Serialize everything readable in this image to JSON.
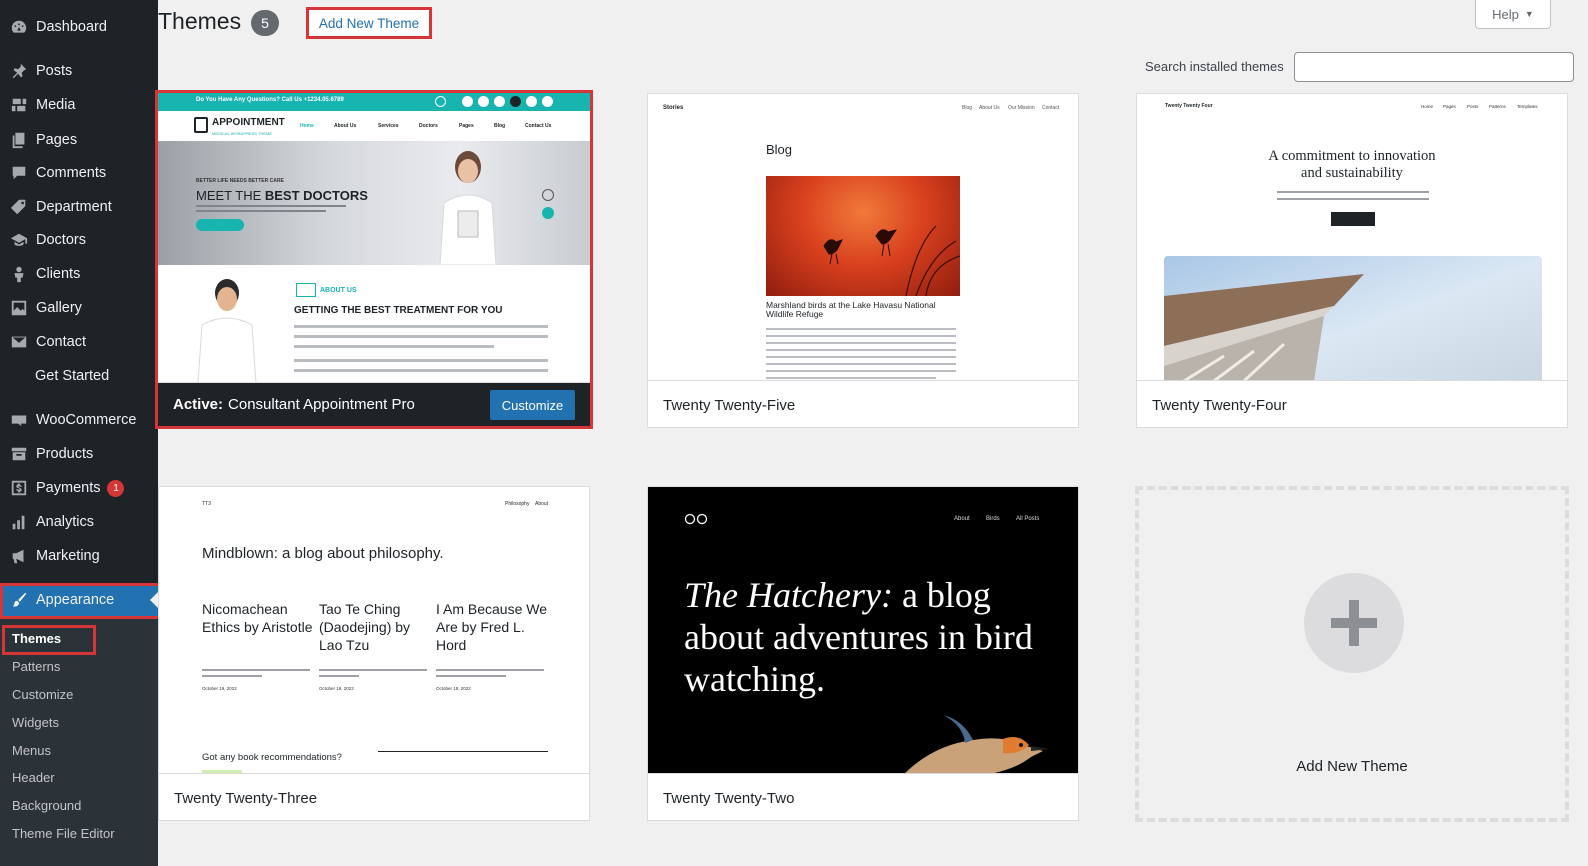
{
  "sidebar": {
    "items": [
      {
        "label": "Dashboard",
        "icon": "dashboard-icon"
      },
      {
        "label": "Posts",
        "icon": "pin-icon"
      },
      {
        "label": "Media",
        "icon": "media-icon"
      },
      {
        "label": "Pages",
        "icon": "pages-icon"
      },
      {
        "label": "Comments",
        "icon": "comment-icon"
      },
      {
        "label": "Department",
        "icon": "tag-icon"
      },
      {
        "label": "Doctors",
        "icon": "graduation-cap-icon"
      },
      {
        "label": "Clients",
        "icon": "person-icon"
      },
      {
        "label": "Gallery",
        "icon": "gallery-icon"
      },
      {
        "label": "Contact",
        "icon": "envelope-icon"
      },
      {
        "label": "Get Started",
        "icon": ""
      },
      {
        "label": "WooCommerce",
        "icon": "woo-icon"
      },
      {
        "label": "Products",
        "icon": "archive-icon"
      },
      {
        "label": "Payments",
        "icon": "dollar-icon",
        "badge": "1"
      },
      {
        "label": "Analytics",
        "icon": "bar-chart-icon"
      },
      {
        "label": "Marketing",
        "icon": "megaphone-icon"
      },
      {
        "label": "Appearance",
        "icon": "brush-icon"
      }
    ],
    "submenu": [
      "Themes",
      "Patterns",
      "Customize",
      "Widgets",
      "Menus",
      "Header",
      "Background",
      "Theme File Editor"
    ]
  },
  "header": {
    "title": "Themes",
    "count": "5",
    "add_new_label": "Add New Theme",
    "help_label": "Help",
    "search_label": "Search installed themes",
    "search_value": ""
  },
  "themes": {
    "active": {
      "prefix": "Active:",
      "name": "Consultant Appointment Pro",
      "customize_label": "Customize",
      "preview": {
        "topbar_text": "Do You Have Any Questions? Call Us +1234.05.6789",
        "logo": "APPOINTMENT",
        "logo_sub": "MEDICAL WORDPRESS THEME",
        "menu": [
          "Home",
          "About Us",
          "Services",
          "Doctors",
          "Pages",
          "Blog",
          "Contact Us"
        ],
        "hero_small": "BETTER LIFE NEEDS BETTER CARE",
        "hero_title_normal": "MEET THE ",
        "hero_title_bold": "BEST DOCTORS",
        "about_tag": "ABOUT US",
        "about_title": "GETTING THE BEST TREATMENT FOR YOU"
      }
    },
    "tt5": {
      "name": "Twenty Twenty-Five",
      "preview": {
        "site": "Stories",
        "nav": [
          "Blog",
          "About Us",
          "Our Mission",
          "Contact"
        ],
        "heading": "Blog",
        "caption": "Marshland birds at the Lake Havasu National Wildlife Refuge"
      }
    },
    "tt4": {
      "name": "Twenty Twenty-Four",
      "preview": {
        "site": "Twenty Twenty Four",
        "nav": [
          "Home",
          "Pages",
          "Posts",
          "Patterns",
          "Templates"
        ],
        "heading_line1": "A commitment to innovation",
        "heading_line2": "and sustainability"
      }
    },
    "tt3": {
      "name": "Twenty Twenty-Three",
      "preview": {
        "site": "TT3",
        "nav": [
          "Philosophy",
          "About"
        ],
        "heading": "Mindblown: a blog about philosophy.",
        "posts": [
          "Nicomachean Ethics by Aristotle",
          "Tao Te Ching (Daodejing) by Lao Tzu",
          "I Am Because We Are by Fred L. Hord"
        ],
        "date": "October 19, 2022",
        "ask": "Got any book recommendations?"
      }
    },
    "tt2": {
      "name": "Twenty Twenty-Two",
      "preview": {
        "nav": [
          "About",
          "Birds",
          "All Posts"
        ],
        "headline_italic": "The Hatchery:",
        "headline_rest": " a blog about adventures in bird watching."
      }
    },
    "add_new": {
      "label": "Add New Theme"
    }
  },
  "colors": {
    "sidebar_bg": "#1d2327",
    "accent": "#2271b1",
    "highlight_outline": "#d63638",
    "teal": "#17b4b0"
  }
}
